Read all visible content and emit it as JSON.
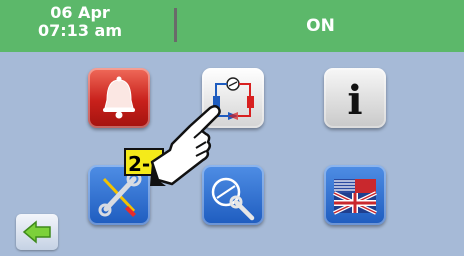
{
  "header": {
    "date": "06 Apr",
    "time": "07:13 am",
    "status": "ON"
  },
  "menu": {
    "alarm": {
      "icon": "bell-icon"
    },
    "circuit": {
      "icon": "refrigeration-circuit-icon"
    },
    "info": {
      "icon": "info-icon",
      "glyph": "i"
    },
    "tools": {
      "icon": "screwdriver-wrench-icon"
    },
    "service": {
      "icon": "compressor-wrench-icon"
    },
    "language": {
      "icon": "uk-flag-icon"
    }
  },
  "overlay": {
    "step_label": "2-"
  },
  "colors": {
    "header_bg": "#5cb86a",
    "screen_bg": "#a6bad7",
    "alarm_red": "#c8201b",
    "button_blue": "#1e5cbf",
    "step_yellow": "#f5ea1a"
  }
}
